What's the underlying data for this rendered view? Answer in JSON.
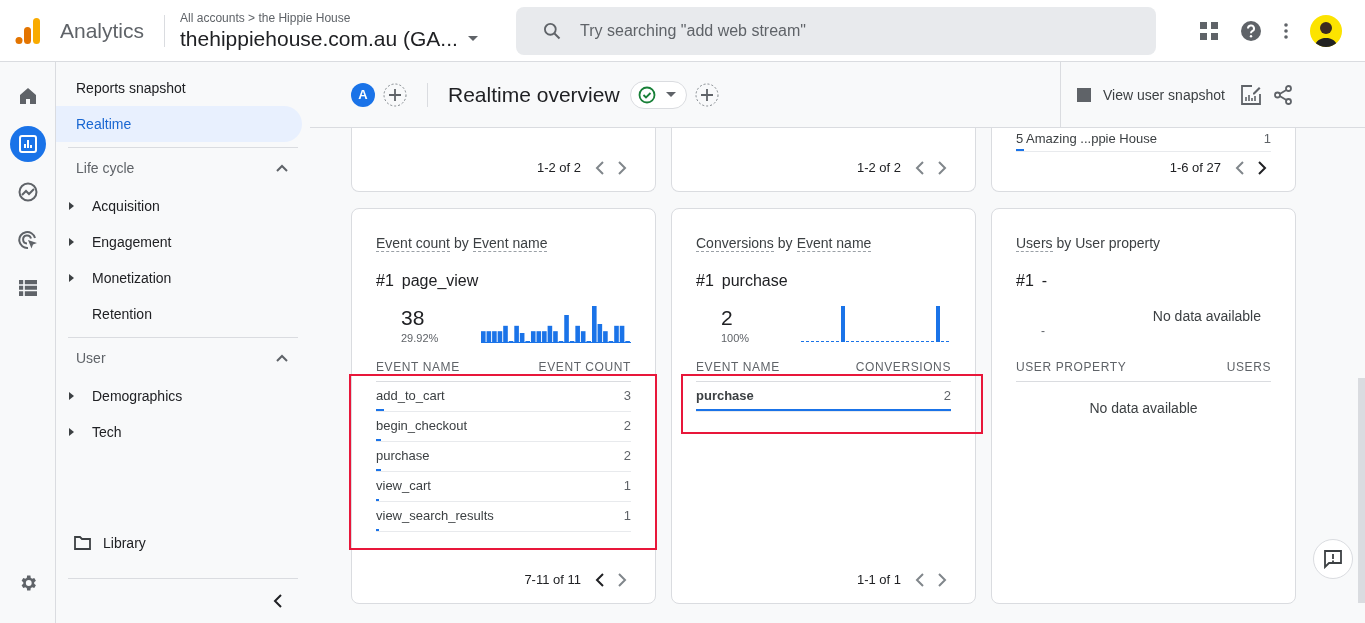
{
  "header": {
    "product": "Analytics",
    "breadcrumb": "All accounts > the Hippie House",
    "property": "thehippiehouse.com.au (GA...",
    "search": {
      "placeholder": "Try searching \"add web stream\""
    }
  },
  "rail": [
    {
      "kind": "home",
      "selected": false
    },
    {
      "kind": "reports",
      "selected": true
    },
    {
      "kind": "explore",
      "selected": false
    },
    {
      "kind": "advertising",
      "selected": false
    },
    {
      "kind": "configure",
      "selected": false
    }
  ],
  "nav": {
    "top": [
      {
        "label": "Reports snapshot",
        "selected": false
      },
      {
        "label": "Realtime",
        "selected": true
      }
    ],
    "sections": [
      {
        "title": "Life cycle",
        "expanded": true,
        "items": [
          {
            "label": "Acquisition",
            "expandable": true
          },
          {
            "label": "Engagement",
            "expandable": true
          },
          {
            "label": "Monetization",
            "expandable": true
          },
          {
            "label": "Retention",
            "expandable": false
          }
        ]
      },
      {
        "title": "User",
        "expanded": true,
        "items": [
          {
            "label": "Demographics",
            "expandable": true
          },
          {
            "label": "Tech",
            "expandable": true
          }
        ]
      }
    ],
    "library": "Library"
  },
  "toolbar": {
    "comparison_letter": "A",
    "title": "Realtime overview",
    "snapshot_label": "View user snapshot"
  },
  "top_cards": [
    {
      "pager": {
        "text": "1-2 of 2",
        "prev_enabled": false,
        "next_enabled": false
      }
    },
    {
      "pager": {
        "text": "1-2 of 2",
        "prev_enabled": false,
        "next_enabled": false
      }
    },
    {
      "row": {
        "name": "5 Amazing ...ppie House",
        "value": "1",
        "level": 0.03
      },
      "pager": {
        "text": "1-6 of 27",
        "prev_enabled": false,
        "next_enabled": true
      }
    }
  ],
  "cards": [
    {
      "kind": "events",
      "title": [
        {
          "text": "Event count",
          "dashed": true
        },
        {
          "text": "by",
          "dashed": false
        },
        {
          "text": "Event name",
          "dashed": true
        }
      ],
      "top_label": "#1",
      "top_name": "page_view",
      "top_value": "38",
      "top_share": "29.92%",
      "columns": [
        "EVENT NAME",
        "EVENT COUNT"
      ],
      "highlighted": true,
      "rows": [
        {
          "name": "add_to_cart",
          "value": "3",
          "level": 0.03
        },
        {
          "name": "begin_checkout",
          "value": "2",
          "level": 0.02
        },
        {
          "name": "purchase",
          "value": "2",
          "level": 0.02
        },
        {
          "name": "view_cart",
          "value": "1",
          "level": 0.01
        },
        {
          "name": "view_search_results",
          "value": "1",
          "level": 0.01
        }
      ],
      "pager": {
        "text": "7-11 of 11",
        "prev_enabled": true,
        "next_enabled": false
      }
    },
    {
      "kind": "conversions",
      "title": [
        {
          "text": "Conversions",
          "dashed": true
        },
        {
          "text": "by",
          "dashed": false
        },
        {
          "text": "Event name",
          "dashed": true
        }
      ],
      "top_label": "#1",
      "top_name": "purchase",
      "top_value": "2",
      "top_share": "100%",
      "columns": [
        "EVENT NAME",
        "CONVERSIONS"
      ],
      "highlighted": true,
      "rows": [
        {
          "name": "purchase",
          "value": "2",
          "level": 1
        }
      ],
      "pager": {
        "text": "1-1 of 1",
        "prev_enabled": false,
        "next_enabled": false
      }
    },
    {
      "kind": "empty",
      "title": [
        {
          "text": "Users",
          "dashed": true
        },
        {
          "text": "by User property",
          "dashed": false
        }
      ],
      "top_label": "#1",
      "top_name": "-",
      "top_value": "-",
      "no_data": "No data available",
      "columns": [
        "USER PROPERTY",
        "USERS"
      ],
      "highlighted": false,
      "table_empty": "No data available"
    }
  ]
}
